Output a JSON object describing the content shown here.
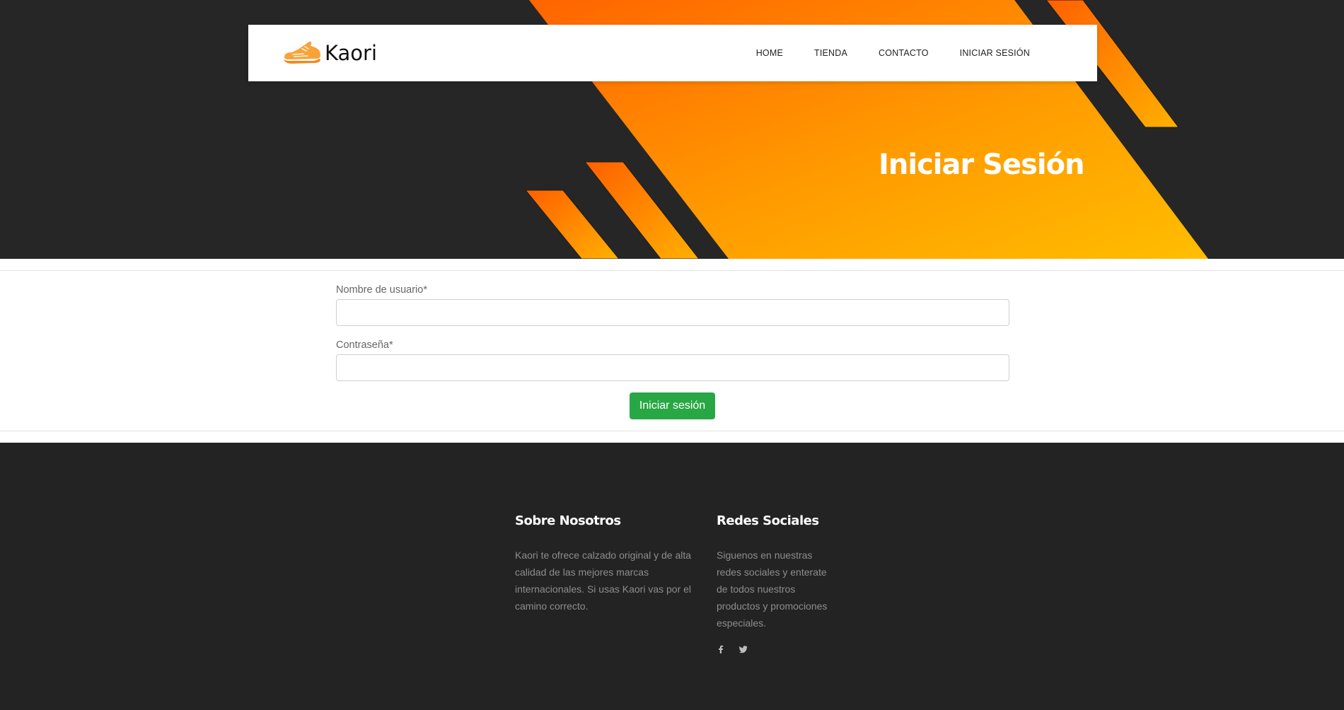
{
  "nav": {
    "brand": "Kaori",
    "links": [
      "HOME",
      "TIENDA",
      "CONTACTO",
      "INICIAR SESIÓN"
    ]
  },
  "hero": {
    "title": "Iniciar Sesión"
  },
  "form": {
    "username_label": "Nombre de usuario*",
    "password_label": "Contraseña*",
    "username_value": "",
    "password_value": "",
    "submit_label": "Iniciar sesión"
  },
  "footer": {
    "about": {
      "heading": "Sobre Nosotros",
      "text": "Kaori te ofrece calzado original y de alta calidad de las mejores marcas internacionales. Si usas Kaori vas por el camino correcto."
    },
    "social": {
      "heading": "Redes Sociales",
      "text": "Siguenos en nuestras redes sociales y enterate de todos nuestros productos y promociones especiales.",
      "icons": [
        "facebook-icon",
        "twitter-icon"
      ]
    }
  },
  "colors": {
    "accent_orange": "#ff6a00",
    "accent_yellow": "#ffb800",
    "dark_bg": "#262626",
    "submit_green": "#28a745"
  }
}
